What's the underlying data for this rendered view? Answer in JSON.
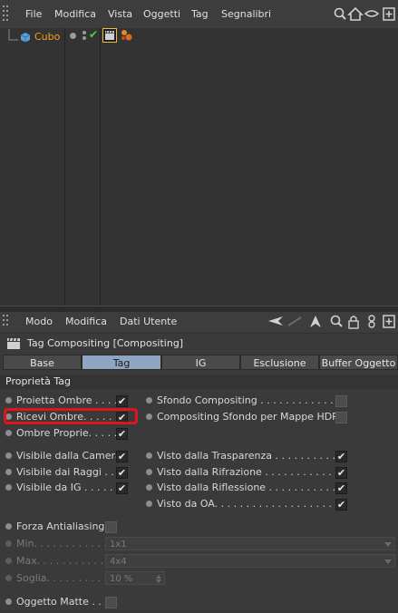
{
  "topmenu": {
    "items": [
      "File",
      "Modifica",
      "Vista",
      "Oggetti",
      "Tag",
      "Segnalibri"
    ]
  },
  "object": {
    "name": "Cubo",
    "check": "✔"
  },
  "attrmenu": {
    "items": [
      "Modo",
      "Modifica",
      "Dati Utente"
    ]
  },
  "tag_title": "Tag Compositing [Compositing]",
  "tabs": [
    {
      "label": "Base",
      "active": false
    },
    {
      "label": "Tag",
      "active": true
    },
    {
      "label": "IG",
      "active": false
    },
    {
      "label": "Esclusione",
      "active": false
    },
    {
      "label": "Buffer Oggetto",
      "active": false
    }
  ],
  "section_title": "Proprietà Tag",
  "props": {
    "proietta_ombre": {
      "label": "Proietta Ombre . . . .",
      "checked": true
    },
    "ricevi_ombre": {
      "label": "Ricevi Ombre. . . . . .",
      "checked": true
    },
    "ombre_proprie": {
      "label": "Ombre Proprie. . . . .",
      "checked": true
    },
    "sfondo_compositing": {
      "label": "Sfondo Compositing . . . . . . . . . . . . . .",
      "checked": false
    },
    "compositing_hdr": {
      "label": "Compositing Sfondo per Mappe HDR",
      "checked": false
    },
    "visibile_camera": {
      "label": "Visibile dalla Camera",
      "checked": true
    },
    "visibile_raggi": {
      "label": "Visibile dai Raggi . .",
      "checked": true
    },
    "visibile_ig": {
      "label": "Visibile da IG . . . . . .",
      "checked": true
    },
    "visto_trasparenza": {
      "label": "Visto dalla Trasparenza . . . . . . . . . . . .",
      "checked": true
    },
    "visto_rifrazione": {
      "label": "Visto dalla Rifrazione . . . . . . . . . . . . .",
      "checked": true
    },
    "visto_riflessione": {
      "label": "Visto dalla Riflessione . . . . . . . . . . . .",
      "checked": true
    },
    "visto_oa": {
      "label": "Visto da OA. . . . . . . . . . . . . . . . . . . . .",
      "checked": true
    },
    "forza_antialiasing": {
      "label": "Forza Antialiasing",
      "checked": false
    },
    "min": {
      "label": "Min. . . . . . . . . . . . .",
      "value": "1x1"
    },
    "max": {
      "label": "Max. . . . . . . . . . . . .",
      "value": "4x4"
    },
    "soglia": {
      "label": "Soglia. . . . . . . . . . .",
      "value": "10 %"
    },
    "oggetto_matte": {
      "label": "Oggetto Matte . .",
      "checked": false
    }
  },
  "check_glyph": "✔",
  "colors": {
    "accent_tab": "#8fa6c2",
    "object_name": "#f0a020",
    "highlight": "#e0141c"
  }
}
